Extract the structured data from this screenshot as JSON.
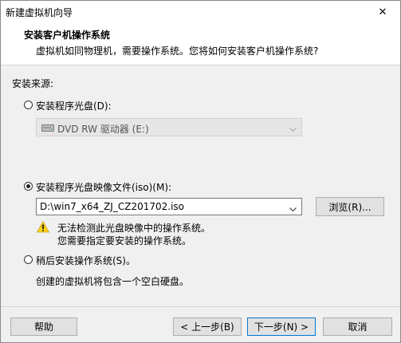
{
  "window": {
    "title": "新建虚拟机向导",
    "close_glyph": "✕"
  },
  "header": {
    "title": "安装客户机操作系统",
    "subtitle": "虚拟机如同物理机，需要操作系统。您将如何安装客户机操作系统?"
  },
  "install_source": {
    "label": "安装来源:",
    "disc_option": {
      "label": "安装程序光盘(D):",
      "selected": false
    },
    "disc_drive": {
      "value": "DVD RW 驱动器 (E:)",
      "enabled": false,
      "icon": "optical-drive-icon"
    },
    "iso_option": {
      "label": "安装程序光盘映像文件(iso)(M):",
      "selected": true
    },
    "iso_path": {
      "value": "D:\\win7_x64_ZJ_CZ201702.iso"
    },
    "browse_label": "浏览(R)...",
    "warning": {
      "icon": "warning-icon",
      "line1": "无法检测此光盘映像中的操作系统。",
      "line2": "您需要指定要安装的操作系统。"
    },
    "later_option": {
      "label": "稍后安装操作系统(S)。",
      "selected": false
    },
    "later_desc": "创建的虚拟机将包含一个空白硬盘。"
  },
  "footer": {
    "help": "帮助",
    "back": "< 上一步(B)",
    "next": "下一步(N) >",
    "cancel": "取消"
  }
}
